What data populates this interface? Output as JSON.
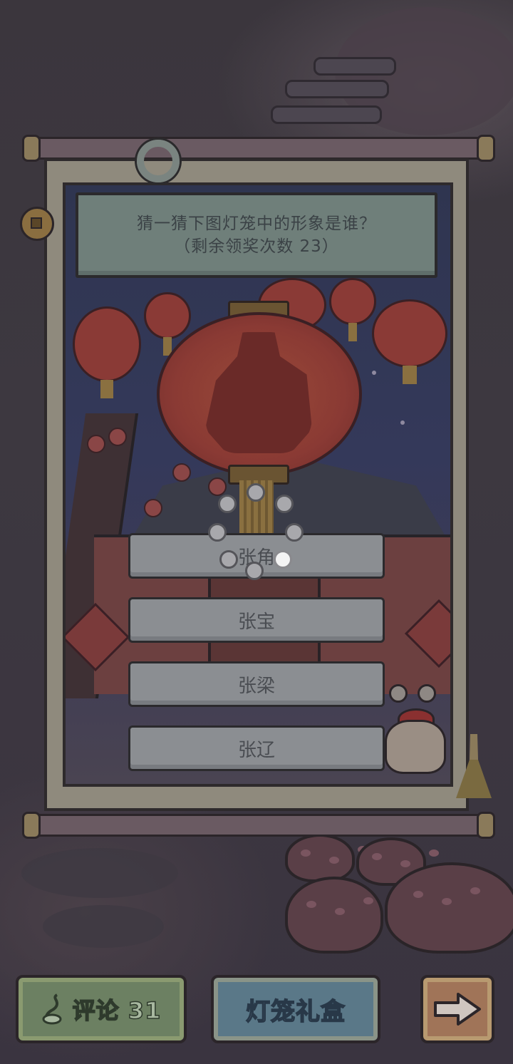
{
  "question": {
    "line1": "猜一猜下图灯笼中的形象是谁？",
    "line2": "（剩余领奖次数  23）"
  },
  "answers": [
    {
      "label": "张角"
    },
    {
      "label": "张宝"
    },
    {
      "label": "张梁"
    },
    {
      "label": "张辽"
    }
  ],
  "bottom_bar": {
    "comment_label": "评论 31",
    "gift_label": "灯笼礼盒",
    "next_icon": "arrow-right-icon",
    "comment_icon": "quill-icon"
  },
  "loading_indicator": {
    "icon": "loading-spinner-icon"
  },
  "colors": {
    "question_bg": "#6f7f7a",
    "answer_bg": "#8b8e92",
    "comment_button": "#6c8062",
    "gift_button": "#5a7888",
    "next_button": "#a07458"
  }
}
